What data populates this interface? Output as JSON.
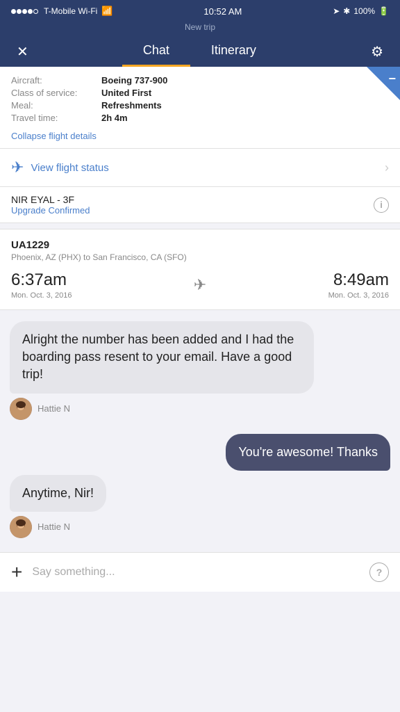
{
  "statusBar": {
    "carrier": "T-Mobile Wi-Fi",
    "time": "10:52 AM",
    "battery": "100%"
  },
  "header": {
    "tripLabel": "New trip",
    "closeLabel": "✕",
    "tabs": [
      {
        "label": "Chat",
        "active": true
      },
      {
        "label": "Itinerary",
        "active": false
      }
    ],
    "gearIcon": "⚙"
  },
  "flightDetails": {
    "aircraft": {
      "label": "Aircraft:",
      "value": "Boeing 737-900"
    },
    "classOfService": {
      "label": "Class of service:",
      "value": "United First"
    },
    "meal": {
      "label": "Meal:",
      "value": "Refreshments"
    },
    "travelTime": {
      "label": "Travel time:",
      "value": "2h 4m"
    },
    "collapseLink": "Collapse flight details",
    "viewFlightStatus": "View flight status"
  },
  "seatInfo": {
    "passenger": "NIR EYAL - 3F",
    "upgradeLabel": "Upgrade Confirmed"
  },
  "nextFlight": {
    "flightNumber": "UA1229",
    "route": "Phoenix, AZ (PHX) to San Francisco, CA (SFO)",
    "departTime": "6:37am",
    "departDate": "Mon. Oct. 3, 2016",
    "arriveTime": "8:49am",
    "arriveDate": "Mon. Oct. 3, 2016"
  },
  "chat": {
    "messages": [
      {
        "id": 1,
        "side": "left",
        "text": "Alright the number has been added and I had the boarding pass resent to your email. Have a good trip!",
        "agent": "Hattie N"
      },
      {
        "id": 2,
        "side": "right",
        "text": "You're awesome! Thanks"
      },
      {
        "id": 3,
        "side": "left",
        "text": "Anytime, Nir!",
        "agent": "Hattie N"
      }
    ]
  },
  "bottomBar": {
    "placeholder": "Say something...",
    "plusLabel": "+",
    "helpLabel": "?"
  }
}
